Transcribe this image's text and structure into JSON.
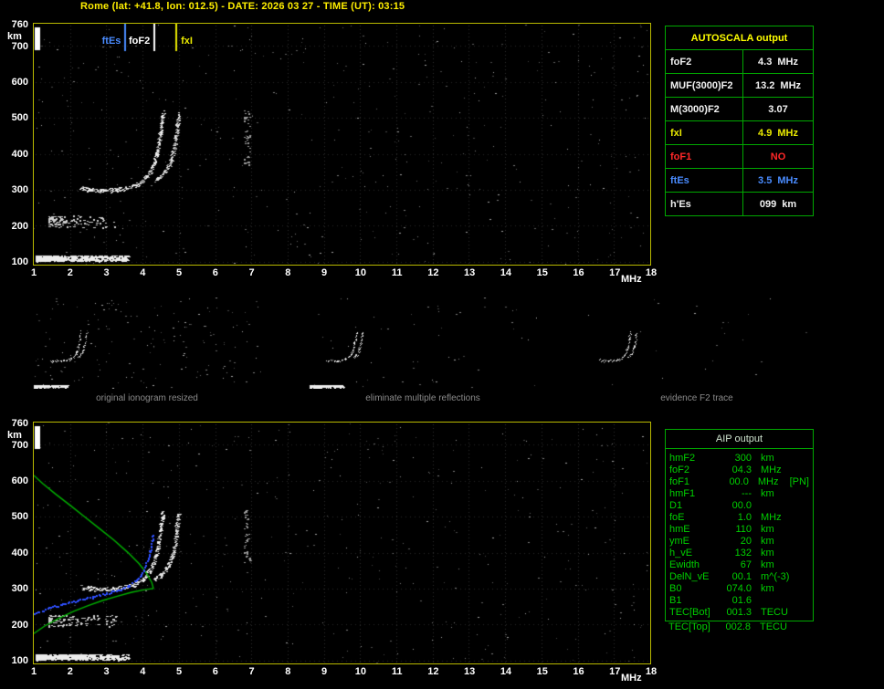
{
  "header": {
    "title": "Rome (lat: +41.8, lon: 012.5) - DATE: 2026 03 27 - TIME (UT): 03:15"
  },
  "plots": {
    "x_ticks": [
      "1",
      "2",
      "3",
      "4",
      "5",
      "6",
      "7",
      "8",
      "9",
      "10",
      "11",
      "12",
      "13",
      "14",
      "15",
      "16",
      "17",
      "18"
    ],
    "x_unit": "MHz",
    "y_ticks": [
      "760",
      "700",
      "600",
      "500",
      "400",
      "300",
      "200",
      "100"
    ],
    "y_unit": "km",
    "markers": [
      {
        "label": "ftEs",
        "freq": 3.5,
        "color": "#4a8cff",
        "side": "left"
      },
      {
        "label": "foF2",
        "freq": 4.3,
        "color": "#ffffff",
        "side": "left"
      },
      {
        "label": "fxI",
        "freq": 4.9,
        "color": "#e8e800",
        "side": "right"
      }
    ]
  },
  "thumbnails": [
    {
      "caption": "original ionogram resized"
    },
    {
      "caption": "eliminate multiple reflections"
    },
    {
      "caption": "evidence F2 trace"
    }
  ],
  "autoscala": {
    "title": "AUTOSCALA output",
    "border_color": "#00a800",
    "rows": [
      {
        "label": "foF2",
        "value": "4.3",
        "unit": "MHz",
        "color": "#f2f2f2"
      },
      {
        "label": "MUF(3000)F2",
        "value": "13.2",
        "unit": "MHz",
        "color": "#f2f2f2"
      },
      {
        "label": "M(3000)F2",
        "value": "3.07",
        "unit": "",
        "color": "#f2f2f2"
      },
      {
        "label": "fxI",
        "value": "4.9",
        "unit": "MHz",
        "color": "#e8e800"
      },
      {
        "label": "foF1",
        "value": "NO",
        "unit": "",
        "color": "#ff2828"
      },
      {
        "label": "ftEs",
        "value": "3.5",
        "unit": "MHz",
        "color": "#4a8cff"
      },
      {
        "label": "h'Es",
        "value": "099",
        "unit": "km",
        "color": "#f2f2f2"
      }
    ]
  },
  "aip": {
    "title": "AIP output",
    "text_color": "#00d000",
    "rows": [
      {
        "name": "hmF2",
        "value": "300",
        "unit": "km",
        "extra": ""
      },
      {
        "name": "foF2",
        "value": "04.3",
        "unit": "MHz",
        "extra": ""
      },
      {
        "name": "foF1",
        "value": "00.0",
        "unit": "MHz",
        "extra": "[PN]"
      },
      {
        "name": "hmF1",
        "value": "---",
        "unit": "km",
        "extra": ""
      },
      {
        "name": "D1",
        "value": "00.0",
        "unit": "",
        "extra": ""
      },
      {
        "name": "foE",
        "value": "1.0",
        "unit": "MHz",
        "extra": ""
      },
      {
        "name": "hmE",
        "value": "110",
        "unit": "km",
        "extra": ""
      },
      {
        "name": "ymE",
        "value": "20",
        "unit": "km",
        "extra": ""
      },
      {
        "name": "h_vE",
        "value": "132",
        "unit": "km",
        "extra": ""
      },
      {
        "name": "Ewidth",
        "value": "67",
        "unit": "km",
        "extra": ""
      },
      {
        "name": "DelN_vE",
        "value": "00.1",
        "unit": "m^(-3)",
        "extra": ""
      },
      {
        "name": "B0",
        "value": "074.0",
        "unit": "km",
        "extra": ""
      },
      {
        "name": "B1",
        "value": "01.6",
        "unit": "",
        "extra": ""
      },
      {
        "name": "TEC[Bot]",
        "value": "001.3",
        "unit": "TECU",
        "extra": ""
      },
      {
        "name": "TEC[Top]",
        "value": "002.8",
        "unit": "TECU",
        "extra": ""
      }
    ]
  },
  "chart_data": {
    "type": "scatter",
    "title": "Rome ionogram 2026-03-27 03:15 UT",
    "xlabel": "MHz",
    "ylabel": "km",
    "xlim": [
      1,
      18
    ],
    "ylim": [
      100,
      765
    ],
    "series": [
      {
        "name": "f2-trace-o",
        "style": "speckle",
        "color": "#ececec",
        "points": [
          [
            2.3,
            306
          ],
          [
            2.5,
            302
          ],
          [
            2.7,
            300
          ],
          [
            2.9,
            299
          ],
          [
            3.1,
            300
          ],
          [
            3.3,
            302
          ],
          [
            3.5,
            305
          ],
          [
            3.7,
            310
          ],
          [
            3.85,
            317
          ],
          [
            4.0,
            326
          ],
          [
            4.1,
            337
          ],
          [
            4.2,
            352
          ],
          [
            4.3,
            374
          ],
          [
            4.38,
            400
          ],
          [
            4.44,
            430
          ],
          [
            4.49,
            462
          ],
          [
            4.53,
            495
          ],
          [
            4.56,
            516
          ]
        ]
      },
      {
        "name": "f2-trace-x",
        "style": "speckle",
        "color": "#e0e0e0",
        "points": [
          [
            4.35,
            328
          ],
          [
            4.5,
            338
          ],
          [
            4.62,
            351
          ],
          [
            4.72,
            367
          ],
          [
            4.8,
            389
          ],
          [
            4.87,
            417
          ],
          [
            4.92,
            449
          ],
          [
            4.96,
            481
          ],
          [
            4.99,
            511
          ]
        ]
      },
      {
        "name": "es-layer",
        "style": "band",
        "color": "#ececec",
        "f": [
          1.05,
          3.6
        ],
        "h": [
          103,
          118
        ],
        "bias": "left",
        "density": 1.2
      },
      {
        "name": "es-multiple",
        "style": "band",
        "color": "#cfcfcf",
        "f": [
          1.4,
          3.25
        ],
        "h": [
          196,
          228
        ],
        "bias": "left",
        "density": 0.12
      },
      {
        "name": "interference-streak",
        "style": "band",
        "color": "#9a9a9a",
        "f": [
          6.78,
          6.95
        ],
        "h": [
          370,
          520
        ],
        "bias": "none",
        "density": 0.1
      },
      {
        "name": "ne-profile-bottomside",
        "style": "line",
        "color": "#00b400",
        "points": [
          [
            1.0,
            175
          ],
          [
            1.3,
            196
          ],
          [
            1.7,
            218
          ],
          [
            2.1,
            237
          ],
          [
            2.5,
            253
          ],
          [
            2.9,
            267
          ],
          [
            3.3,
            279
          ],
          [
            3.7,
            290
          ],
          [
            4.0,
            296
          ],
          [
            4.2,
            299
          ],
          [
            4.3,
            300
          ]
        ]
      },
      {
        "name": "ne-profile-topside",
        "style": "line",
        "color": "#00b400",
        "points": [
          [
            4.3,
            300
          ],
          [
            4.25,
            318
          ],
          [
            4.1,
            344
          ],
          [
            3.9,
            370
          ],
          [
            3.6,
            400
          ],
          [
            3.2,
            436
          ],
          [
            2.8,
            468
          ],
          [
            2.4,
            500
          ],
          [
            2.0,
            532
          ],
          [
            1.6,
            563
          ],
          [
            1.25,
            592
          ],
          [
            1.0,
            615
          ]
        ]
      },
      {
        "name": "restored-trace",
        "style": "dots",
        "color": "#2e4fff",
        "points": [
          [
            1.0,
            232
          ],
          [
            1.4,
            247
          ],
          [
            1.8,
            259
          ],
          [
            2.2,
            269
          ],
          [
            2.6,
            278
          ],
          [
            3.0,
            288
          ],
          [
            3.3,
            297
          ],
          [
            3.6,
            309
          ],
          [
            3.8,
            323
          ],
          [
            3.95,
            341
          ],
          [
            4.05,
            361
          ],
          [
            4.15,
            386
          ],
          [
            4.22,
            416
          ],
          [
            4.28,
            452
          ]
        ]
      }
    ]
  }
}
